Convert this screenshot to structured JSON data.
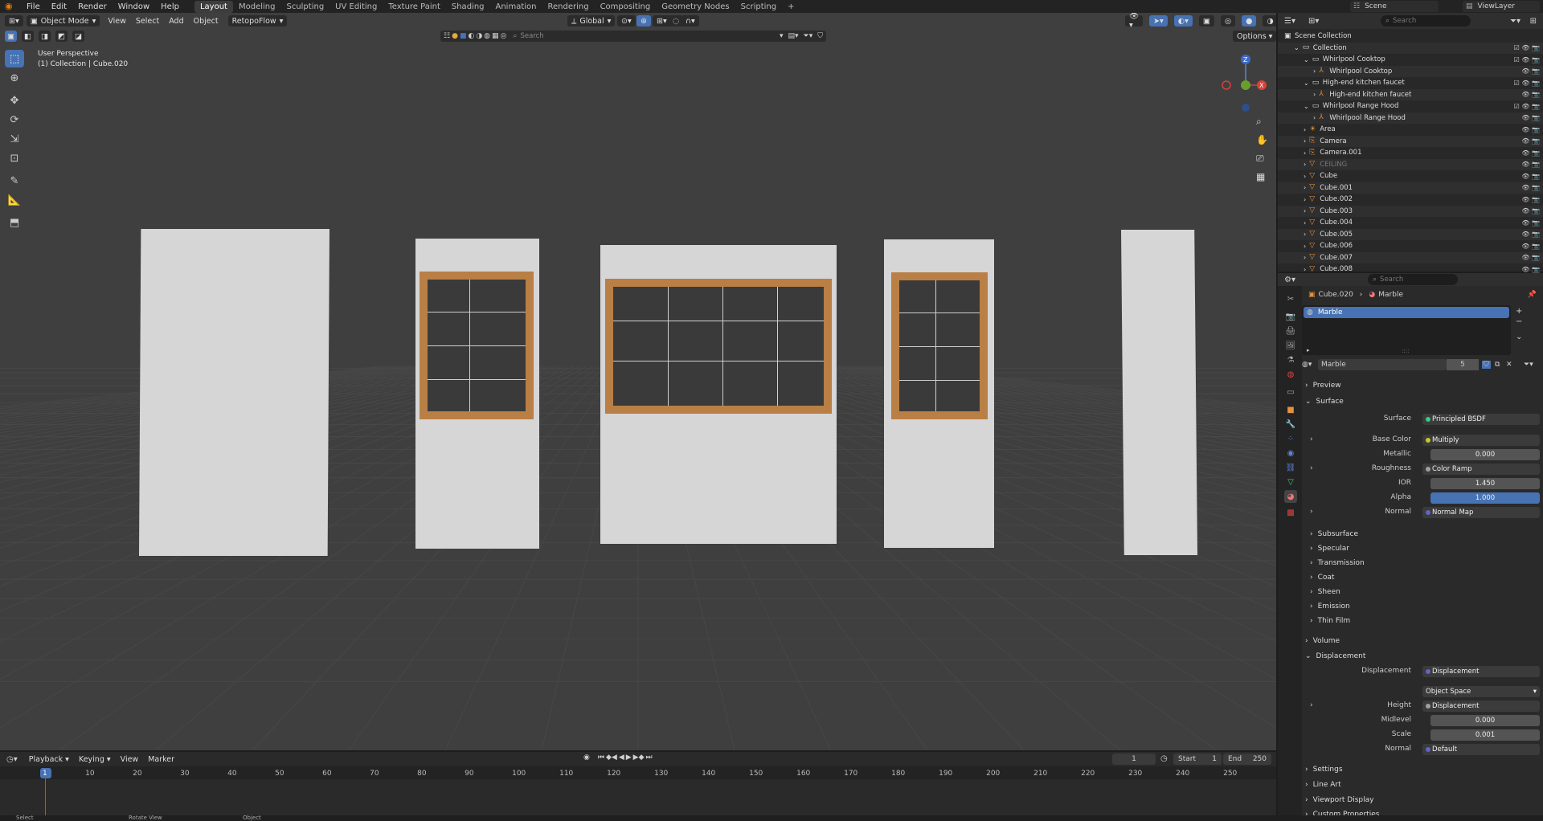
{
  "topbar": {
    "menus": [
      "File",
      "Edit",
      "Render",
      "Window",
      "Help"
    ],
    "workspaces": [
      "Layout",
      "Modeling",
      "Sculpting",
      "UV Editing",
      "Texture Paint",
      "Shading",
      "Animation",
      "Rendering",
      "Compositing",
      "Geometry Nodes",
      "Scripting"
    ],
    "active_workspace": "Layout",
    "add": "+",
    "scene": "Scene",
    "view_layer": "ViewLayer"
  },
  "viewport": {
    "mode": "Object Mode",
    "menus": [
      "View",
      "Select",
      "Add",
      "Object"
    ],
    "addon": "RetopoFlow",
    "orientation": "Global",
    "search_placeholder": "Search",
    "options": "Options",
    "overlay_title": "User Perspective",
    "overlay_sub": "(1) Collection | Cube.020"
  },
  "outliner": {
    "search_placeholder": "Search",
    "rows": [
      {
        "label": "Scene Collection",
        "indent": 0,
        "icon": "scene-collection-icon"
      },
      {
        "label": "Collection",
        "indent": 1,
        "icon": "collection-icon"
      },
      {
        "label": "Whirlpool Cooktop",
        "indent": 2,
        "icon": "collection-icon"
      },
      {
        "label": "Whirlpool Cooktop",
        "indent": 3,
        "icon": "armature-icon"
      },
      {
        "label": "High-end kitchen faucet",
        "indent": 2,
        "icon": "collection-icon"
      },
      {
        "label": "High-end kitchen faucet",
        "indent": 3,
        "icon": "armature-icon"
      },
      {
        "label": "Whirlpool Range Hood",
        "indent": 2,
        "icon": "collection-icon"
      },
      {
        "label": "Whirlpool Range Hood",
        "indent": 3,
        "icon": "armature-icon"
      },
      {
        "label": "Area",
        "indent": 2,
        "icon": "light-icon"
      },
      {
        "label": "Camera",
        "indent": 2,
        "icon": "camera-icon"
      },
      {
        "label": "Camera.001",
        "indent": 2,
        "icon": "camera-icon"
      },
      {
        "label": "CEILING",
        "indent": 2,
        "icon": "mesh-icon"
      },
      {
        "label": "Cube",
        "indent": 2,
        "icon": "mesh-icon"
      },
      {
        "label": "Cube.001",
        "indent": 2,
        "icon": "mesh-icon"
      },
      {
        "label": "Cube.002",
        "indent": 2,
        "icon": "mesh-icon"
      },
      {
        "label": "Cube.003",
        "indent": 2,
        "icon": "mesh-icon"
      },
      {
        "label": "Cube.004",
        "indent": 2,
        "icon": "mesh-icon"
      },
      {
        "label": "Cube.005",
        "indent": 2,
        "icon": "mesh-icon"
      },
      {
        "label": "Cube.006",
        "indent": 2,
        "icon": "mesh-icon"
      },
      {
        "label": "Cube.007",
        "indent": 2,
        "icon": "mesh-icon"
      },
      {
        "label": "Cube.008",
        "indent": 2,
        "icon": "mesh-icon"
      }
    ]
  },
  "properties": {
    "search_placeholder": "Search",
    "breadcrumb_object": "Cube.020",
    "breadcrumb_material": "Marble",
    "slot": "Marble",
    "material_name": "Marble",
    "users": "5",
    "sections": {
      "preview": "Preview",
      "surface": "Surface",
      "subsurface": "Subsurface",
      "specular": "Specular",
      "transmission": "Transmission",
      "coat": "Coat",
      "sheen": "Sheen",
      "emission": "Emission",
      "thin_film": "Thin Film",
      "volume": "Volume",
      "displacement": "Displacement",
      "settings": "Settings",
      "line_art": "Line Art",
      "viewport_display": "Viewport Display",
      "custom_properties": "Custom Properties"
    },
    "fields": {
      "surface_label": "Surface",
      "surface_value": "Principled BSDF",
      "base_color_label": "Base Color",
      "base_color_value": "Multiply",
      "metallic_label": "Metallic",
      "metallic_value": "0.000",
      "roughness_label": "Roughness",
      "roughness_value": "Color Ramp",
      "ior_label": "IOR",
      "ior_value": "1.450",
      "alpha_label": "Alpha",
      "alpha_value": "1.000",
      "normal_label": "Normal",
      "normal_value": "Normal Map",
      "disp_label": "Displacement",
      "disp_value": "Displacement",
      "space_value": "Object Space",
      "height_label": "Height",
      "height_value": "Displacement",
      "midlevel_label": "Midlevel",
      "midlevel_value": "0.000",
      "scale_label": "Scale",
      "scale_value": "0.001",
      "dnormal_label": "Normal",
      "dnormal_value": "Default"
    }
  },
  "timeline": {
    "menus": [
      "Playback",
      "Keying",
      "View",
      "Marker"
    ],
    "current_frame": "1",
    "start_label": "Start",
    "start": "1",
    "end_label": "End",
    "end": "250",
    "ticks": [
      "1",
      "10",
      "20",
      "30",
      "40",
      "50",
      "60",
      "70",
      "80",
      "90",
      "100",
      "110",
      "120",
      "130",
      "140",
      "150",
      "160",
      "170",
      "180",
      "190",
      "200",
      "210",
      "220",
      "230",
      "240",
      "250"
    ]
  },
  "statusbar": {
    "items": [
      "Select",
      "Rotate View",
      "Object"
    ]
  }
}
